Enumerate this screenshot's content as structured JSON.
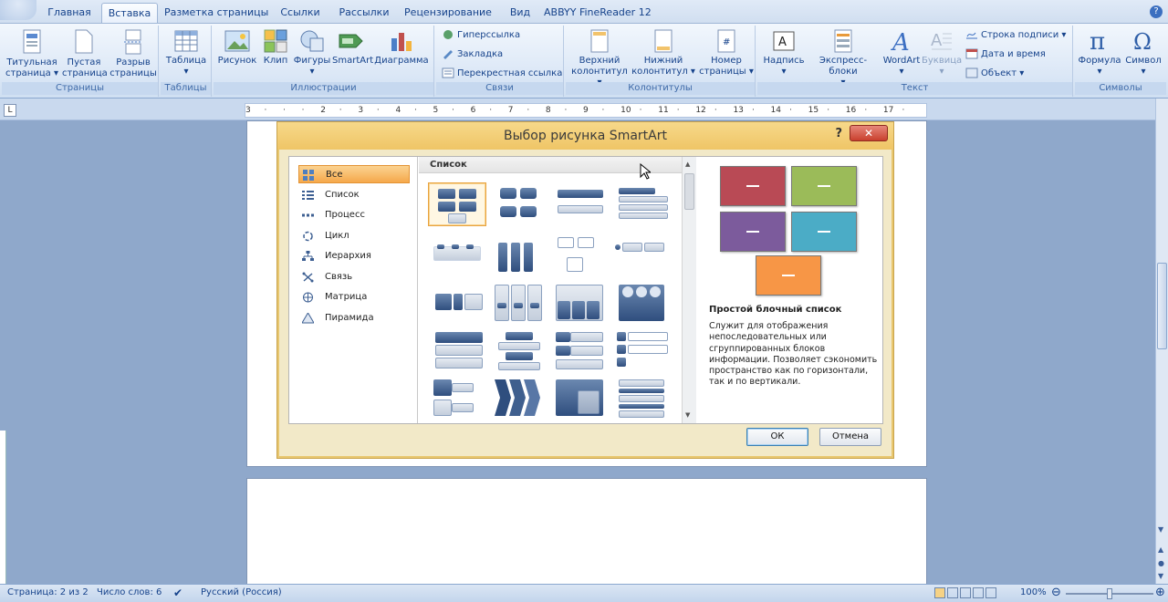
{
  "ribbon_tabs": [
    "Главная",
    "Вставка",
    "Разметка страницы",
    "Ссылки",
    "Рассылки",
    "Рецензирование",
    "Вид",
    "ABBYY FineReader 12"
  ],
  "groups": {
    "pages": {
      "label": "Страницы",
      "buttons": [
        "Титульная страница",
        "Пустая страница",
        "Разрыв страницы"
      ]
    },
    "tables": {
      "label": "Таблицы",
      "buttons": [
        "Таблица"
      ]
    },
    "illustrations": {
      "label": "Иллюстрации",
      "buttons": [
        "Рисунок",
        "Клип",
        "Фигуры",
        "SmartArt",
        "Диаграмма"
      ]
    },
    "links": {
      "label": "Связи",
      "buttons": [
        "Гиперссылка",
        "Закладка",
        "Перекрестная ссылка"
      ]
    },
    "headers": {
      "label": "Колонтитулы",
      "buttons": [
        "Верхний колонтитул",
        "Нижний колонтитул",
        "Номер страницы"
      ]
    },
    "text": {
      "label": "Текст",
      "buttons": [
        "Надпись",
        "Экспресс-блоки",
        "WordArt",
        "Буквица"
      ],
      "small": [
        "Строка подписи",
        "Дата и время",
        "Объект"
      ]
    },
    "symbols": {
      "label": "Символы",
      "buttons": [
        "Формула",
        "Символ"
      ]
    }
  },
  "ruler_ticks": [
    "3",
    "1",
    "1",
    "1",
    "2",
    "1",
    "3",
    "1",
    "4",
    "1",
    "5",
    "1",
    "6",
    "1",
    "7",
    "1",
    "8",
    "1",
    "9",
    "1",
    "10",
    "1",
    "11",
    "1",
    "12",
    "1",
    "13",
    "1",
    "14",
    "1",
    "15",
    "1",
    "16",
    "1",
    "17",
    "1"
  ],
  "dialog": {
    "title": "Выбор рисунка SmartArt",
    "help": "?",
    "close": "✕",
    "categories": [
      "Все",
      "Список",
      "Процесс",
      "Цикл",
      "Иерархия",
      "Связь",
      "Матрица",
      "Пирамида"
    ],
    "selected_category": "Все",
    "gallery_header": "Список",
    "preview_colors": [
      "#b94a55",
      "#9bbb59",
      "#7c5b9c",
      "#4bacc6",
      "#f79646"
    ],
    "preview_title": "Простой блочный список",
    "preview_desc": "Служит для отображения непоследовательных или сгруппированных блоков информации. Позволяет сэкономить пространство как по горизонтали, так и по вертикали.",
    "ok": "ОК",
    "cancel": "Отмена"
  },
  "status": {
    "page": "Страница: 2 из 2",
    "words": "Число слов: 6",
    "lang": "Русский (Россия)",
    "zoom": "100%",
    "zoom_level": 100
  }
}
